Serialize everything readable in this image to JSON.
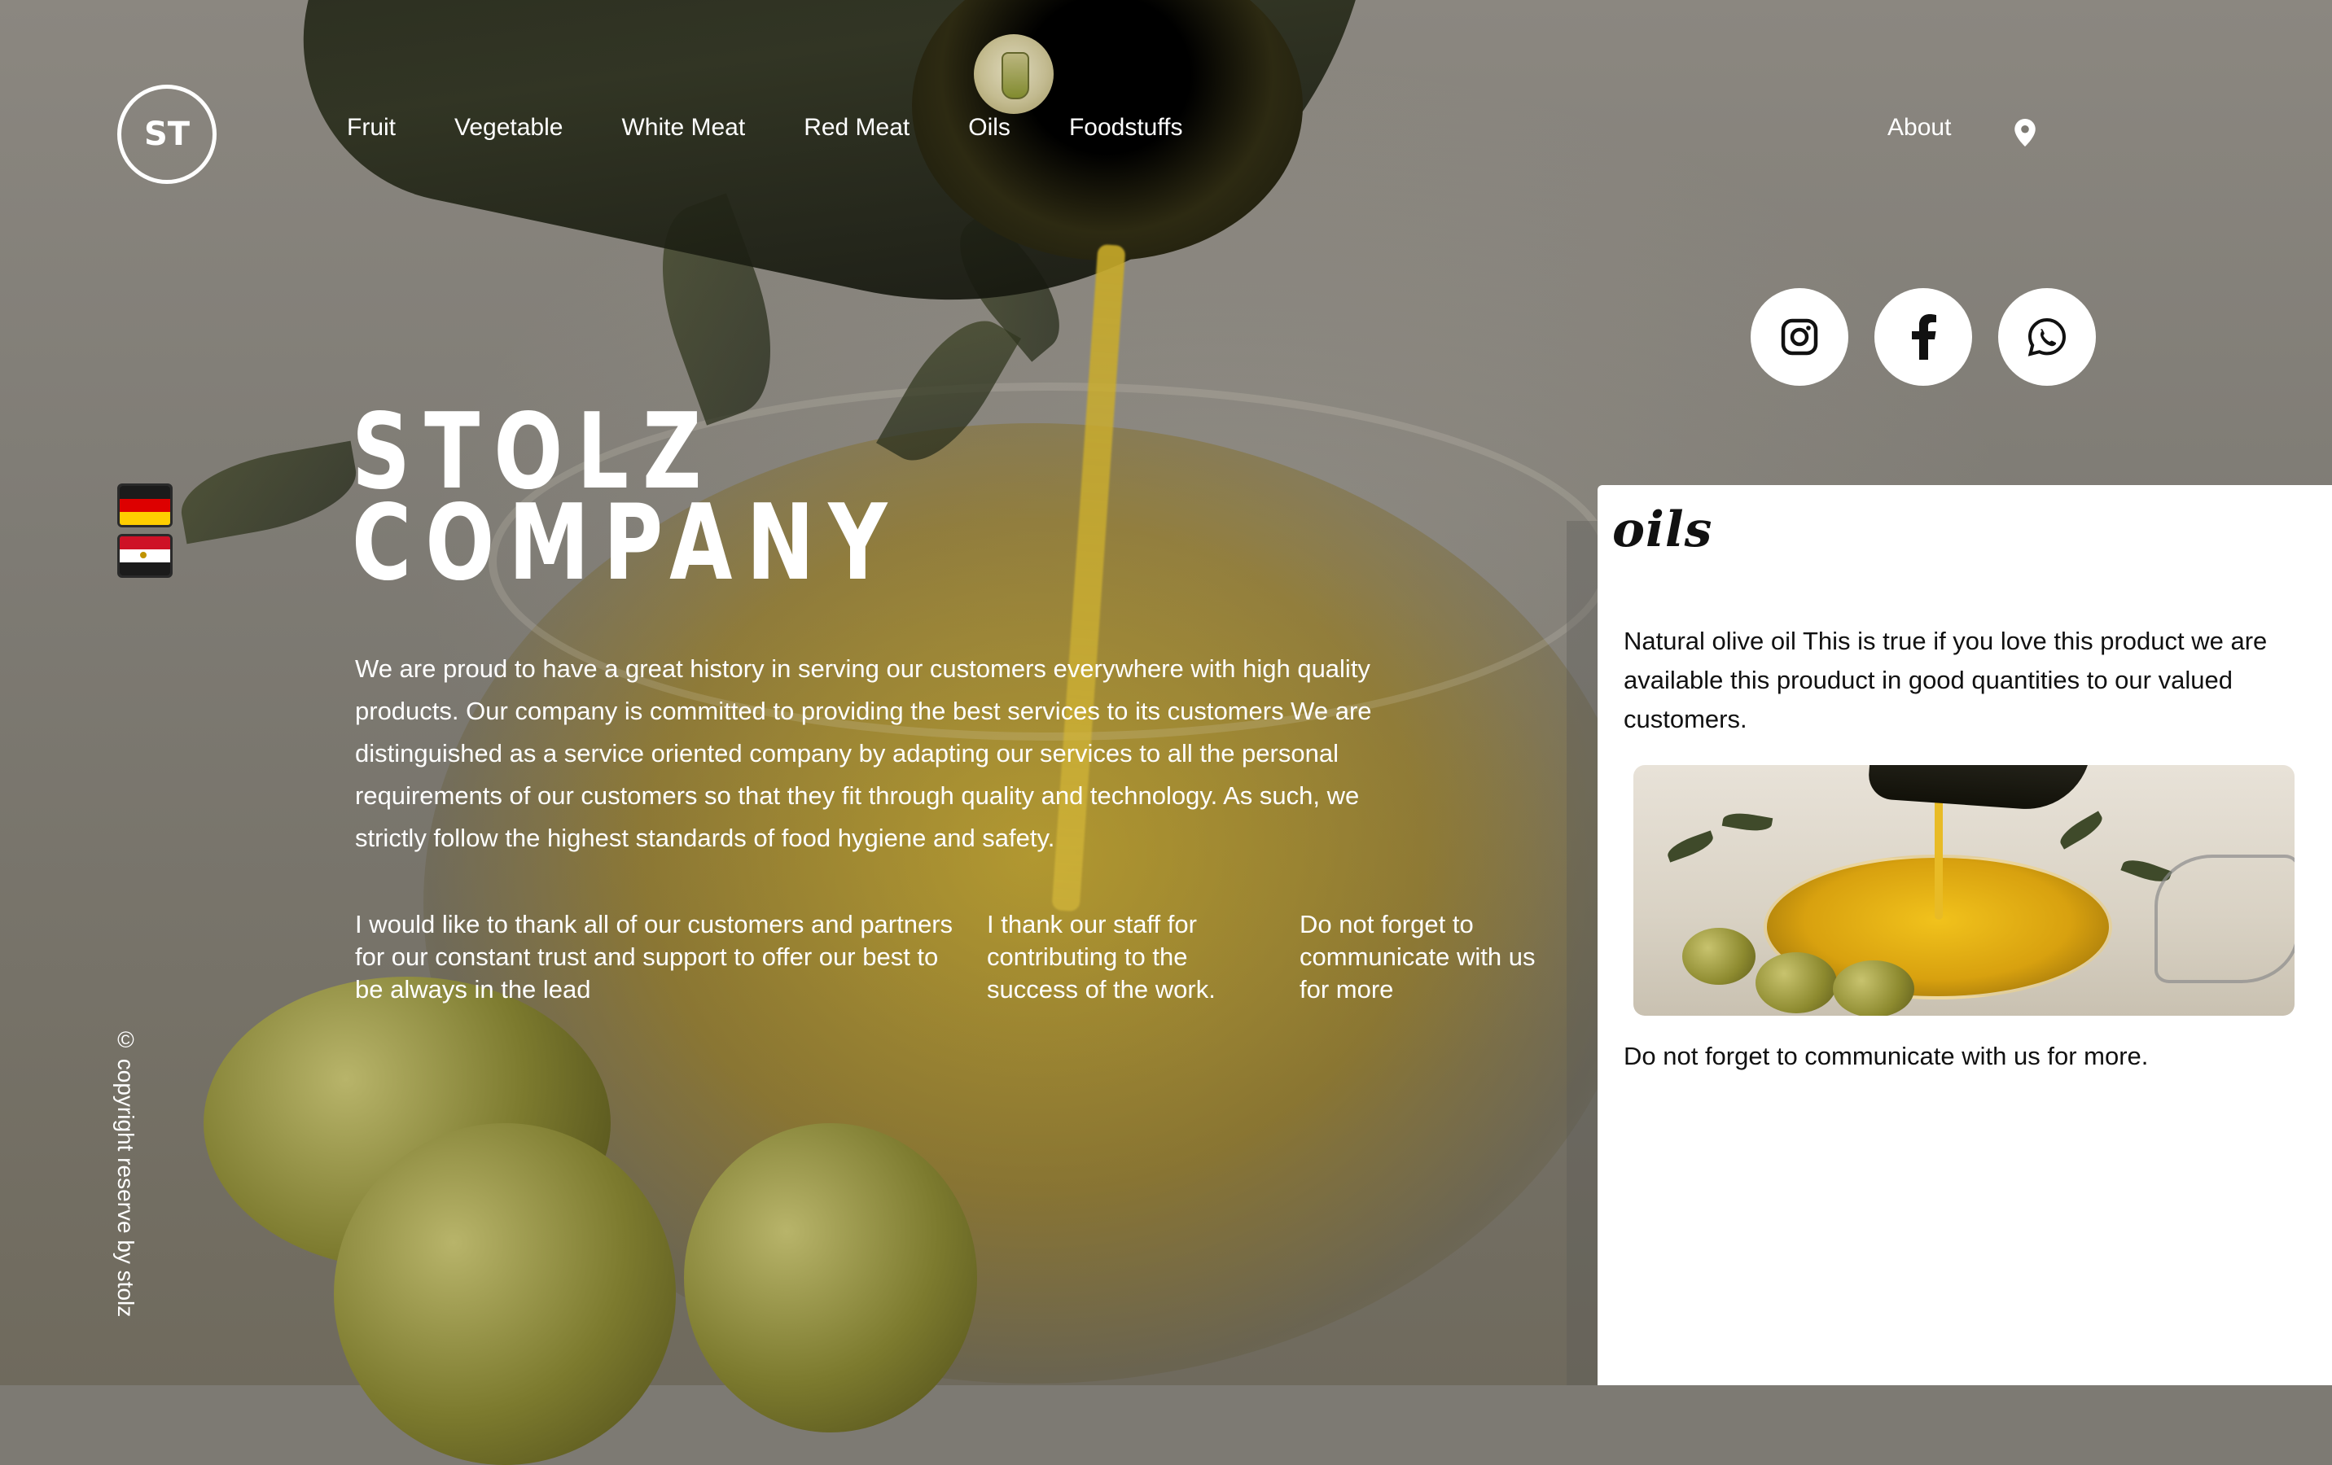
{
  "brand": {
    "logo_text": "ST"
  },
  "nav": {
    "items": [
      "Fruit",
      "Vegetable",
      "White Meat",
      "Red Meat",
      "Oils",
      "Foodstuffs"
    ],
    "about": "About"
  },
  "icons": {
    "location": "map-pin-icon",
    "social": [
      "instagram-icon",
      "facebook-icon",
      "whatsapp-icon"
    ],
    "flags": [
      "germany-flag-icon",
      "egypt-flag-icon"
    ]
  },
  "hero": {
    "title_line1": "STOLZ",
    "title_line2": "COMPANY",
    "intro": "We are proud to have a great history in serving our customers everywhere with high quality products. Our company is committed to providing the best services to its customers We are distinguished as a service oriented company by adapting our services to all the personal requirements of our customers so that they fit through quality and technology. As such, we strictly follow the highest standards of food hygiene and safety.",
    "columns": [
      "I would like to thank all of our customers and partners for our constant trust and support to offer our best to be always in the lead",
      "I thank our staff for contributing to the success of the work.",
      "Do not forget to communicate with us for more"
    ]
  },
  "footer": {
    "copyright": "© copyright reserve by stolz"
  },
  "panel": {
    "title": "oils",
    "description": "Natural olive oil This is true if you love this product we are available this prouduct in good quantities to our valued customers.",
    "footer": "Do not forget to communicate with us for more."
  },
  "colors": {
    "panel_bg": "#ffffff",
    "text_on_image": "#ffffff",
    "germany": [
      "#000000",
      "#dd0000",
      "#ffce00"
    ],
    "egypt": [
      "#ce1126",
      "#ffffff",
      "#000000"
    ]
  }
}
